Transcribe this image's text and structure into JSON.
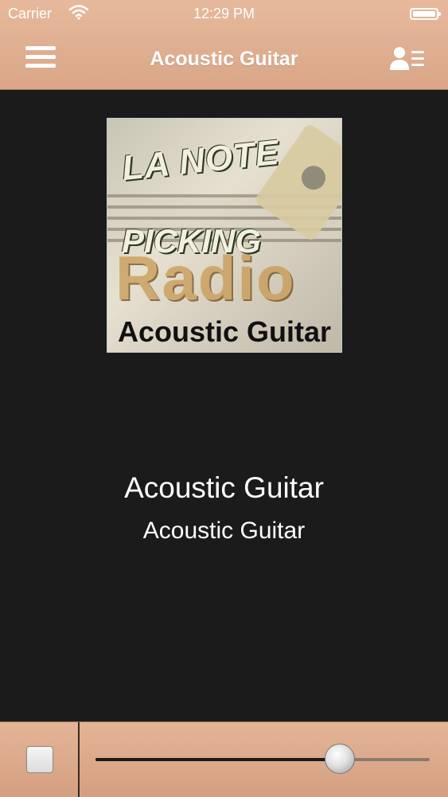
{
  "status_bar": {
    "carrier": "Carrier",
    "time": "12:29 PM",
    "wifi_icon": "wifi-icon",
    "battery_icon": "battery-icon"
  },
  "nav": {
    "title": "Acoustic Guitar",
    "menu_icon": "hamburger-menu-icon",
    "profile_icon": "profile-list-icon"
  },
  "album_art": {
    "lines": [
      "LA NOTE",
      "PICKING",
      "Radio",
      "Acoustic Guitar"
    ]
  },
  "now_playing": {
    "title": "Acoustic Guitar",
    "subtitle": "Acoustic Guitar"
  },
  "player": {
    "stop_icon": "stop-icon",
    "volume": 0.73
  },
  "colors": {
    "bar_bg": "#dca88a",
    "main_bg": "#1b1b1b",
    "text": "#ffffff"
  }
}
